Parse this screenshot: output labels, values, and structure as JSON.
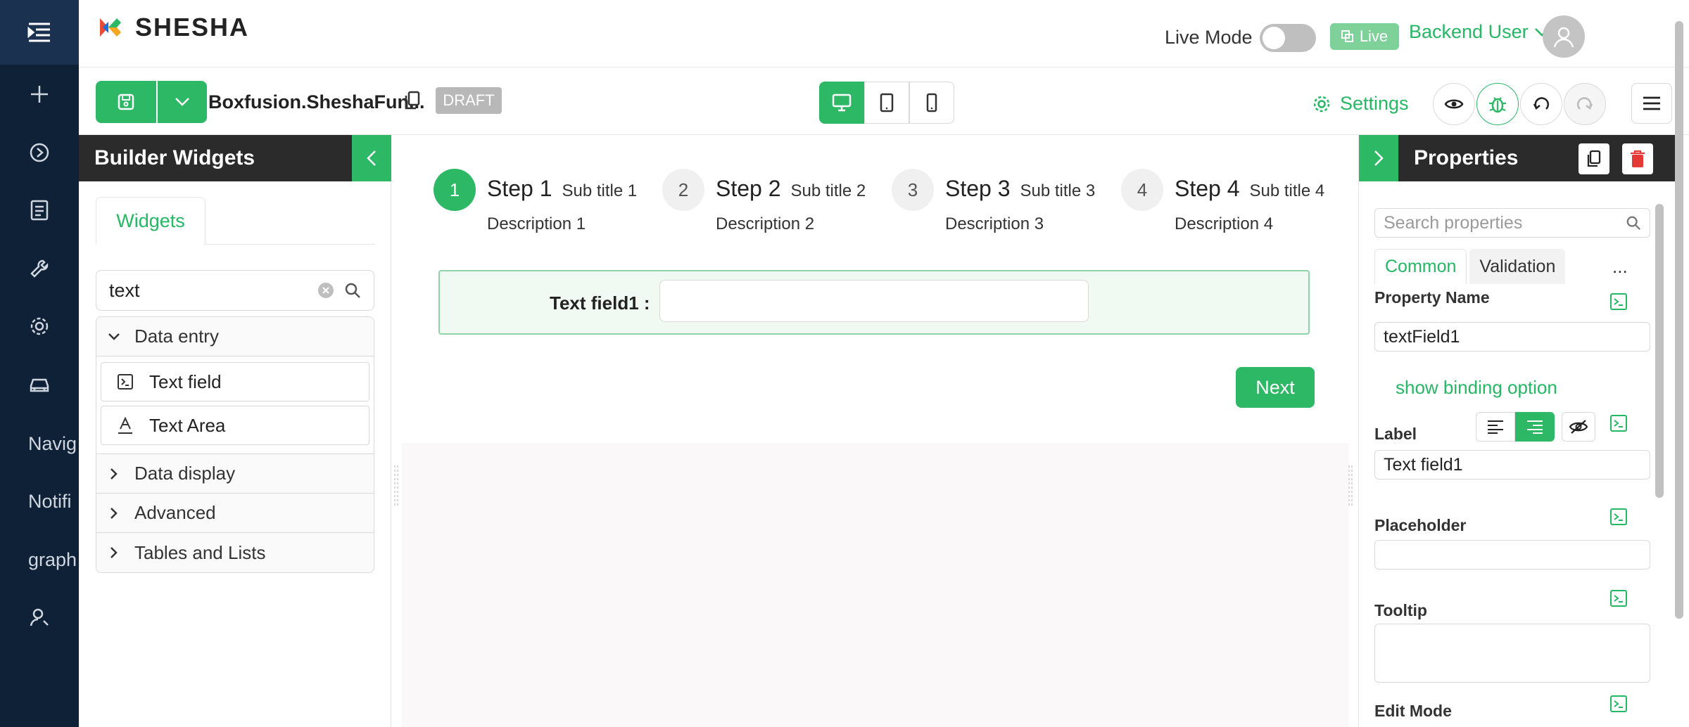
{
  "nav": {
    "items": [
      {
        "icon": "menu-icon"
      },
      {
        "icon": "plus-icon"
      },
      {
        "icon": "play-circle-icon"
      },
      {
        "icon": "document-icon"
      },
      {
        "icon": "wrench-icon"
      },
      {
        "icon": "gear-icon"
      },
      {
        "icon": "car-icon"
      }
    ],
    "text_items": [
      "Navig",
      "Notifi",
      "graph"
    ],
    "bottom_icon": "user-settings-icon"
  },
  "header": {
    "brand": "SHESHA",
    "live_mode_label": "Live Mode",
    "live_badge": "Live",
    "user_name": "Backend User"
  },
  "toolbar": {
    "form_name": "Boxfusion.SheshaFun...",
    "status_badge": "DRAFT",
    "settings_label": "Settings"
  },
  "widgets_panel": {
    "title": "Builder Widgets",
    "tab": "Widgets",
    "search_value": "text",
    "groups": [
      {
        "label": "Data entry",
        "expanded": true,
        "items": [
          {
            "label": "Text field",
            "icon": "text-field-icon"
          },
          {
            "label": "Text Area",
            "icon": "text-area-icon"
          }
        ]
      },
      {
        "label": "Data display",
        "expanded": false,
        "items": []
      },
      {
        "label": "Advanced",
        "expanded": false,
        "items": []
      },
      {
        "label": "Tables and Lists",
        "expanded": false,
        "items": []
      }
    ]
  },
  "canvas": {
    "steps": [
      {
        "num": "1",
        "title": "Step 1",
        "subtitle": "Sub title 1",
        "description": "Description 1",
        "active": true
      },
      {
        "num": "2",
        "title": "Step 2",
        "subtitle": "Sub title 2",
        "description": "Description 2",
        "active": false
      },
      {
        "num": "3",
        "title": "Step 3",
        "subtitle": "Sub title 3",
        "description": "Description 3",
        "active": false
      },
      {
        "num": "4",
        "title": "Step 4",
        "subtitle": "Sub title 4",
        "description": "Description 4",
        "active": false
      }
    ],
    "field_label": "Text field1 :",
    "field_value": "",
    "next_label": "Next"
  },
  "properties": {
    "title": "Properties",
    "search_placeholder": "Search properties",
    "tabs": [
      "Common",
      "Validation"
    ],
    "more": "...",
    "property_name_label": "Property Name",
    "property_name_value": "textField1",
    "binding_link": "show binding option",
    "label_label": "Label",
    "label_value": "Text field1",
    "placeholder_label": "Placeholder",
    "placeholder_value": "",
    "tooltip_label": "Tooltip",
    "tooltip_value": "",
    "edit_mode_label": "Edit Mode"
  },
  "colors": {
    "accent": "#2db865",
    "nav_bg": "#0f2137",
    "panel_header": "#2b2b2b"
  }
}
